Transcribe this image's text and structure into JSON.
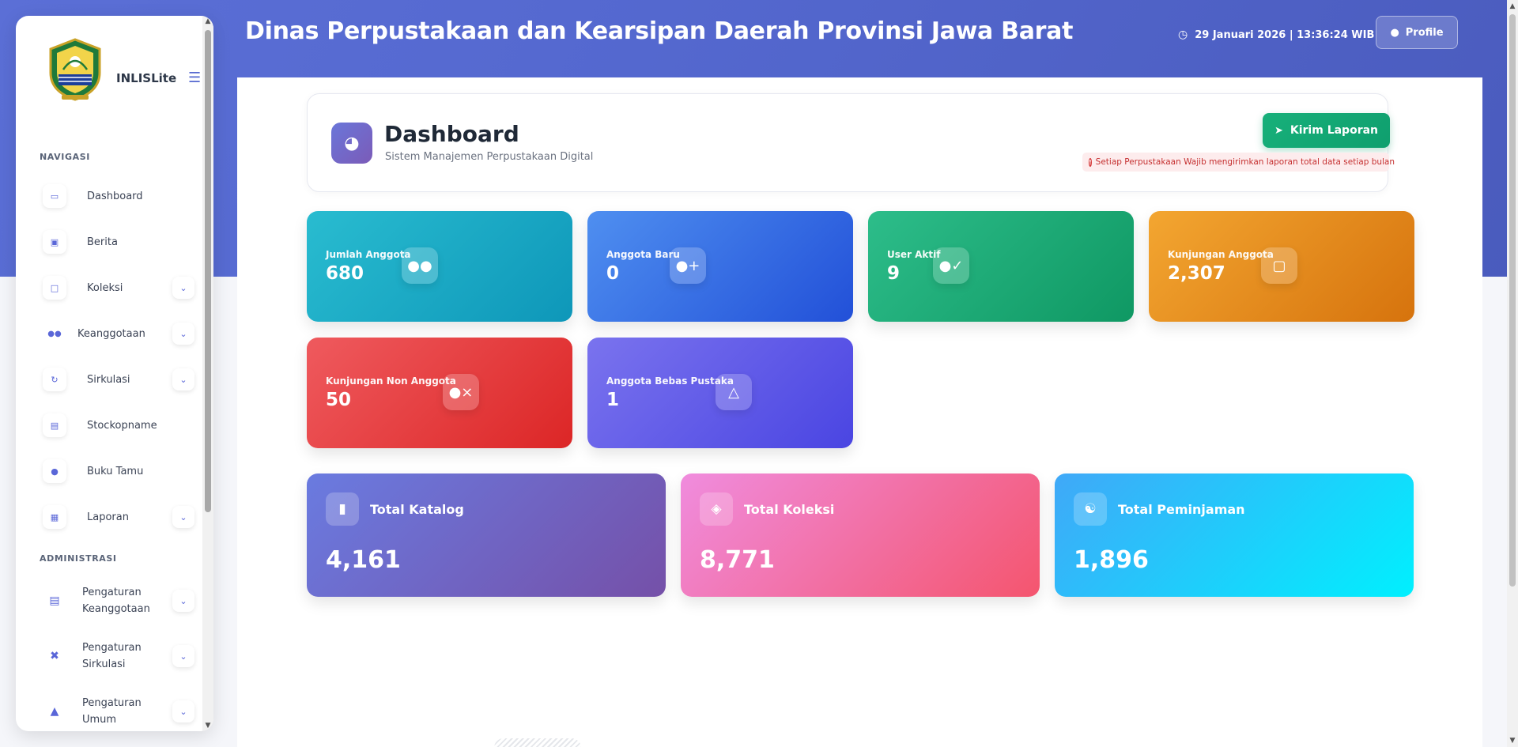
{
  "app": {
    "site_title": "Dinas Perpustakaan dan Kearsipan Daerah Provinsi Jawa Barat",
    "datetime": "29 Januari 2026 | 13:36:24 WIB",
    "profile_label": "Profile",
    "brand": "INLISLite",
    "accent": "#5568d0"
  },
  "sidebar": {
    "section_nav": "NAVIGASI",
    "section_admin": "ADMINISTRASI",
    "items": [
      {
        "label": "Dashboard",
        "icon": "monitor-icon"
      },
      {
        "label": "Berita",
        "icon": "newspaper-icon"
      },
      {
        "label": "Koleksi",
        "icon": "box-icon"
      },
      {
        "label": "Keanggotaan",
        "icon": "users-icon"
      },
      {
        "label": "Sirkulasi",
        "icon": "refresh-icon"
      },
      {
        "label": "Stockopname",
        "icon": "clipboard-icon"
      },
      {
        "label": "Buku Tamu",
        "icon": "user-icon"
      },
      {
        "label": "Laporan",
        "icon": "chart-icon"
      }
    ],
    "admin_items": [
      {
        "label": "Pengaturan Keanggotaan",
        "line1": "Pengaturan",
        "line2": "Keanggotaan",
        "icon": "id-card-icon"
      },
      {
        "label": "Pengaturan Sirkulasi",
        "line1": "Pengaturan",
        "line2": "Sirkulasi",
        "icon": "tools-icon"
      },
      {
        "label": "Pengaturan Umum",
        "line1": "Pengaturan",
        "line2": "Umum",
        "icon": "folder-open-icon"
      }
    ]
  },
  "dashboard": {
    "title": "Dashboard",
    "subtitle": "Sistem Manajemen Perpustakaan Digital",
    "send_report": "Kirim Laporan",
    "notice": "Setiap Perpustakaan Wajib mengirimkan laporan total data setiap bulan",
    "stats": [
      {
        "label": "Jumlah Anggota",
        "value": "680",
        "icon": "users-icon",
        "color_from": "#29bcd0",
        "color_to": "#0e97b9"
      },
      {
        "label": "Anggota Baru",
        "value": "0",
        "icon": "user-plus-icon",
        "color_from": "#4f8ff0",
        "color_to": "#2250d8"
      },
      {
        "label": "User Aktif",
        "value": "9",
        "icon": "user-check-icon",
        "color_from": "#2dbd8a",
        "color_to": "#0f9863"
      },
      {
        "label": "Kunjungan Anggota",
        "value": "2,307",
        "icon": "door-open-icon",
        "color_from": "#f3a631",
        "color_to": "#d6730d"
      },
      {
        "label": "Kunjungan Non Anggota",
        "value": "50",
        "icon": "user-times-icon",
        "color_from": "#ef5a5e",
        "color_to": "#dc2626"
      },
      {
        "label": "Anggota Bebas Pustaka",
        "value": "1",
        "icon": "graduation-cap-icon",
        "color_from": "#7a73ee",
        "color_to": "#4a45e2"
      }
    ],
    "totals": [
      {
        "label": "Total Katalog",
        "value": "4,161",
        "icon": "book-icon",
        "color_from": "#6a7be0",
        "color_to": "#7550a8"
      },
      {
        "label": "Total Koleksi",
        "value": "8,771",
        "icon": "layers-icon",
        "color_from": "#f08cde",
        "color_to": "#f4556e"
      },
      {
        "label": "Total Peminjaman",
        "value": "1,896",
        "icon": "handshake-icon",
        "color_from": "#40a8f8",
        "color_to": "#00f0fe"
      }
    ]
  }
}
